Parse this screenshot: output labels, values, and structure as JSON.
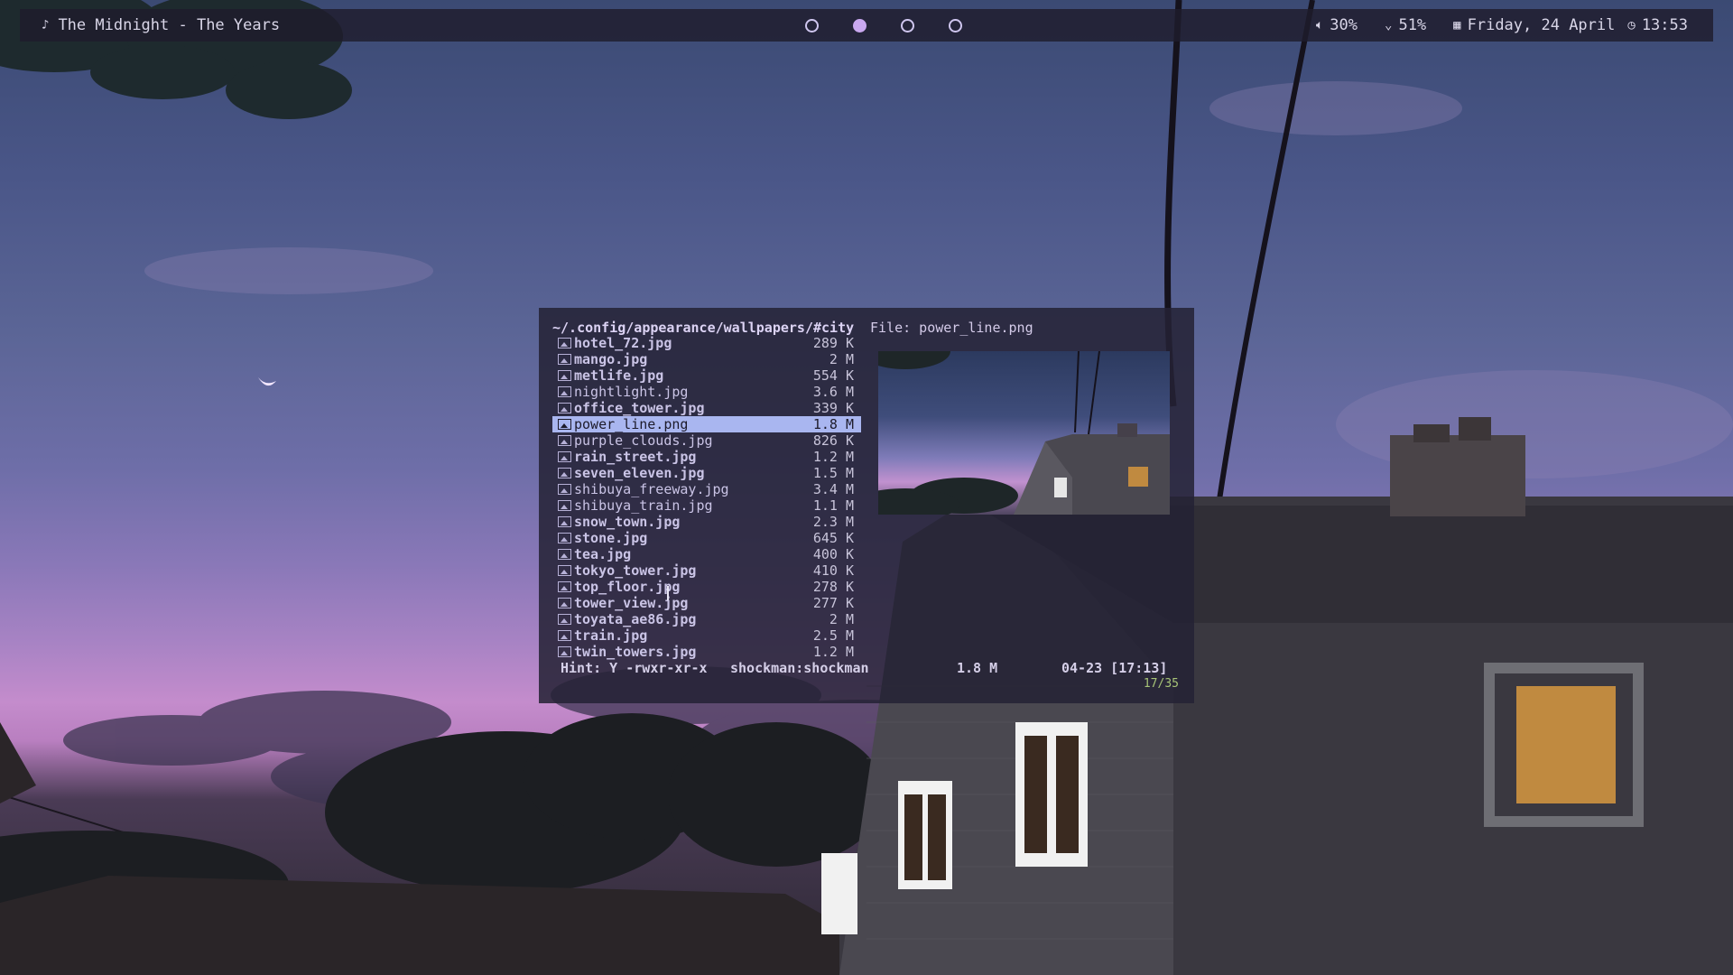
{
  "topbar": {
    "now_playing": "The Midnight - The Years",
    "workspaces": [
      {
        "active": false
      },
      {
        "active": true
      },
      {
        "active": false
      },
      {
        "active": false
      }
    ],
    "volume": "30%",
    "battery": "51%",
    "date": "Friday, 24 April",
    "time": "13:53",
    "icons": {
      "music": "music-note-icon",
      "volume": "speaker-icon",
      "battery": "battery-icon",
      "calendar": "calendar-icon",
      "clock": "clock-icon"
    }
  },
  "ranger": {
    "path": "~/.config/appearance/wallpapers/#city",
    "file_label": "File: power_line.png",
    "files": [
      {
        "name": "hotel_72.jpg",
        "size": "289 K",
        "bold": true
      },
      {
        "name": "mango.jpg",
        "size": "2 M",
        "bold": true
      },
      {
        "name": "metlife.jpg",
        "size": "554 K",
        "bold": true
      },
      {
        "name": "nightlight.jpg",
        "size": "3.6 M",
        "bold": false
      },
      {
        "name": "office_tower.jpg",
        "size": "339 K",
        "bold": true
      },
      {
        "name": "power_line.png",
        "size": "1.8 M",
        "bold": false,
        "selected": true
      },
      {
        "name": "purple_clouds.jpg",
        "size": "826 K",
        "bold": false
      },
      {
        "name": "rain_street.jpg",
        "size": "1.2 M",
        "bold": true
      },
      {
        "name": "seven_eleven.jpg",
        "size": "1.5 M",
        "bold": true
      },
      {
        "name": "shibuya_freeway.jpg",
        "size": "3.4 M",
        "bold": false
      },
      {
        "name": "shibuya_train.jpg",
        "size": "1.1 M",
        "bold": false
      },
      {
        "name": "snow_town.jpg",
        "size": "2.3 M",
        "bold": true
      },
      {
        "name": "stone.jpg",
        "size": "645 K",
        "bold": true
      },
      {
        "name": "tea.jpg",
        "size": "400 K",
        "bold": true
      },
      {
        "name": "tokyo_tower.jpg",
        "size": "410 K",
        "bold": true
      },
      {
        "name": "top_floor.jpg",
        "size": "278 K",
        "bold": true
      },
      {
        "name": "tower_view.jpg",
        "size": "277 K",
        "bold": true
      },
      {
        "name": "toyata_ae86.jpg",
        "size": "2 M",
        "bold": true
      },
      {
        "name": "train.jpg",
        "size": "2.5 M",
        "bold": true
      },
      {
        "name": "twin_towers.jpg",
        "size": "1.2 M",
        "bold": true
      }
    ],
    "status": {
      "hint": "Hint: Y -rwxr-xr-x",
      "owner": "shockman:shockman",
      "size": "1.8 M",
      "mtime": "04-23 [17:13]",
      "position": "17/35"
    }
  }
}
